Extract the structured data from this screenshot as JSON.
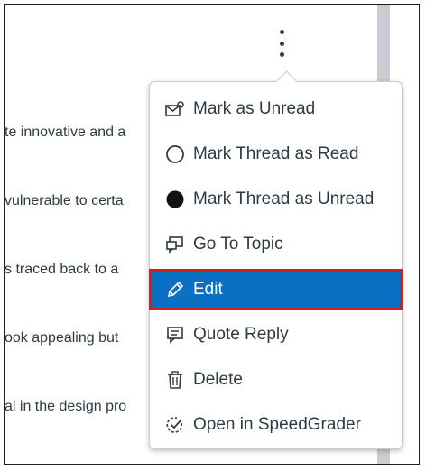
{
  "background_lines": [
    "te innovative and a",
    "vulnerable to certa",
    "s traced back to a",
    "ook appealing but",
    "al in the design pro"
  ],
  "menu": {
    "items": [
      {
        "label": "Mark as Unread",
        "icon": "mail-unread-icon"
      },
      {
        "label": "Mark Thread as Read",
        "icon": "empty-circle-icon"
      },
      {
        "label": "Mark Thread as Unread",
        "icon": "filled-circle-icon"
      },
      {
        "label": "Go To Topic",
        "icon": "discussion-icon"
      },
      {
        "label": "Edit",
        "icon": "pencil-icon",
        "highlighted": true
      },
      {
        "label": "Quote Reply",
        "icon": "quote-reply-icon"
      },
      {
        "label": "Delete",
        "icon": "trash-icon"
      },
      {
        "label": "Open in SpeedGrader",
        "icon": "speedgrader-icon"
      }
    ]
  },
  "colors": {
    "highlight_bg": "#0a70c4",
    "highlight_border": "#e01a1a",
    "text": "#2d3b45"
  }
}
